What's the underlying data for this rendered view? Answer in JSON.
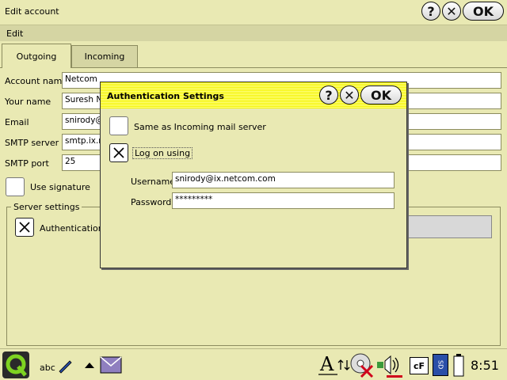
{
  "window": {
    "title": "Edit account",
    "help": "?",
    "close": "✕",
    "ok": "OK"
  },
  "menu": {
    "edit": "Edit"
  },
  "tabs": [
    {
      "label": "Outgoing",
      "active": true
    },
    {
      "label": "Incoming",
      "active": false
    }
  ],
  "form": {
    "account_name_label": "Account name",
    "account_name_value": "Netcom",
    "your_name_label": "Your name",
    "your_name_value": "Suresh Nir",
    "email_label": "Email",
    "email_value": "snirody@",
    "smtp_server_label": "SMTP server",
    "smtp_server_value": "smtp.ix.ne",
    "smtp_port_label": "SMTP port",
    "smtp_port_value": "25",
    "use_signature_label": "Use signature",
    "use_signature_checked": false
  },
  "server_settings": {
    "title": "Server settings",
    "authentication_label": "Authentication",
    "authentication_checked": true
  },
  "dialog": {
    "title": "Authentication Settings",
    "help": "?",
    "close": "✕",
    "ok": "OK",
    "same_as_incoming_label": "Same as Incoming mail server",
    "same_as_incoming_checked": false,
    "log_on_using_label": "Log on using",
    "log_on_using_checked": true,
    "username_label": "Username",
    "username_value": "snirody@ix.netcom.com",
    "password_label": "Password",
    "password_value": "*********"
  },
  "taskbar": {
    "icons": [
      "q-launcher-icon",
      "handwriting-input-icon",
      "up-arrow-icon",
      "mail-icon",
      "font-icon",
      "network-icon",
      "cd-icon",
      "volume-icon",
      "cf-card-icon",
      "sd-card-icon",
      "battery-icon"
    ],
    "clock": "8:51",
    "abc": "abc",
    "cf": "cF",
    "sd": "SD"
  },
  "colors": {
    "background": "#e9e9b3",
    "menubar": "#d5d5a3",
    "dialog_title": "#f4f400"
  }
}
